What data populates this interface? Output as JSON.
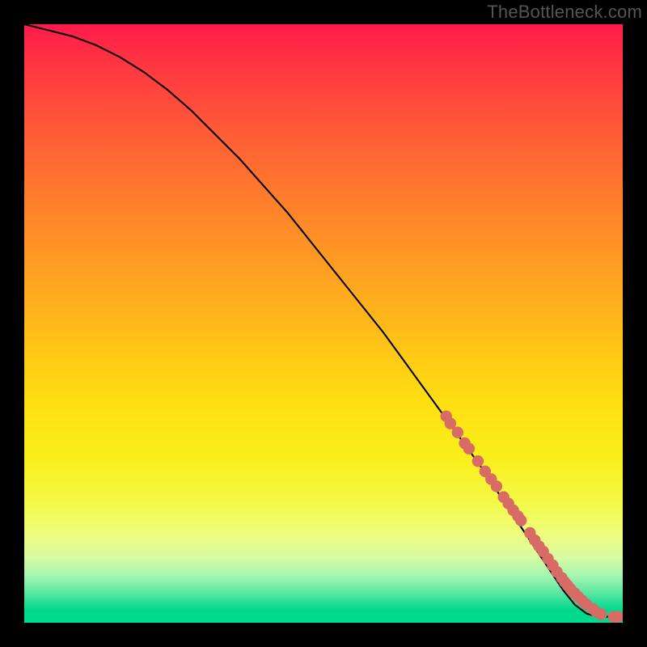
{
  "attribution": "TheBottleneck.com",
  "chart_data": {
    "type": "line",
    "title": "",
    "xlabel": "",
    "ylabel": "",
    "xlim": [
      0,
      100
    ],
    "ylim": [
      0,
      100
    ],
    "grid": false,
    "legend": false,
    "series": [
      {
        "name": "curve",
        "x": [
          0,
          4,
          8,
          12,
          16,
          20,
          24,
          28,
          32,
          36,
          40,
          44,
          48,
          52,
          56,
          60,
          64,
          68,
          72,
          76,
          80,
          84,
          88,
          90,
          92,
          94,
          96,
          98,
          100
        ],
        "y": [
          100,
          99,
          98,
          96.5,
          94.5,
          92,
          89,
          85.5,
          81.5,
          77.5,
          73,
          68.5,
          63.5,
          58.5,
          53.5,
          48.5,
          43,
          37.5,
          32,
          26.5,
          20.5,
          14.5,
          8.5,
          5.5,
          3,
          1.5,
          1,
          1,
          1
        ]
      }
    ],
    "highlight_points": {
      "name": "salmon-dots",
      "x": [
        70.5,
        71.2,
        72.4,
        73.6,
        74.3,
        75.8,
        77.0,
        78.0,
        78.9,
        80.1,
        80.9,
        81.7,
        82.5,
        83.0,
        84.5,
        85.3,
        86.0,
        86.7,
        87.5,
        88.3,
        89.0,
        89.8,
        90.3,
        90.8,
        91.3,
        92.0,
        92.6,
        93.2,
        93.9,
        95.0,
        95.6,
        96.4,
        98.5,
        99.2
      ],
      "y": [
        34.5,
        33.3,
        31.8,
        30.0,
        29.1,
        27.0,
        25.3,
        24.0,
        22.8,
        21.0,
        19.9,
        18.8,
        17.8,
        17.1,
        15.0,
        13.8,
        12.8,
        11.9,
        10.7,
        9.6,
        8.5,
        7.5,
        6.8,
        6.2,
        5.6,
        4.9,
        4.3,
        3.7,
        3.1,
        2.3,
        1.8,
        1.4,
        1.0,
        1.0
      ]
    },
    "gradient_stops": [
      {
        "pos": 0.0,
        "color": "#ff1b4b"
      },
      {
        "pos": 0.4,
        "color": "#ff9c22"
      },
      {
        "pos": 0.72,
        "color": "#f9ee18"
      },
      {
        "pos": 0.92,
        "color": "#a7f6af"
      },
      {
        "pos": 1.0,
        "color": "#00d98e"
      }
    ]
  }
}
